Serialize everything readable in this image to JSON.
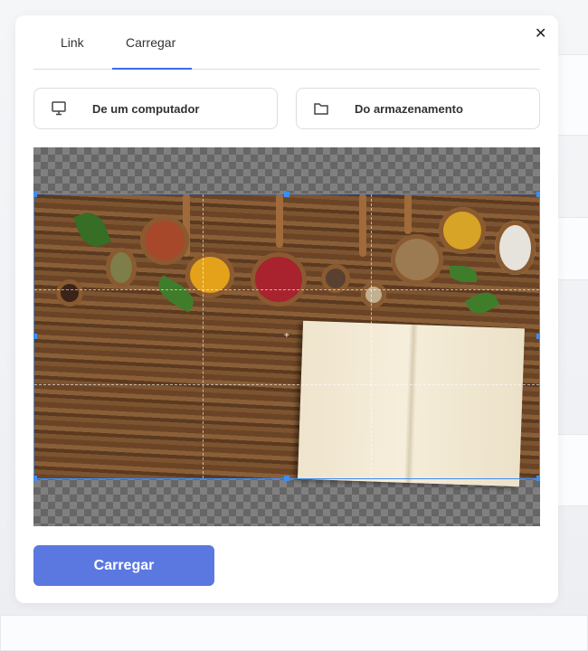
{
  "tabs": [
    {
      "label": "Link",
      "active": false
    },
    {
      "label": "Carregar",
      "active": true
    }
  ],
  "close_icon": "close-icon",
  "sources": [
    {
      "label": "De um computador",
      "icon": "monitor-icon"
    },
    {
      "label": "Do armazenamento",
      "icon": "folder-icon"
    }
  ],
  "upload_button": "Carregar",
  "colors": {
    "accent": "#3a6cf0",
    "button": "#5b78e0",
    "crop_border": "#3d8ef0"
  }
}
